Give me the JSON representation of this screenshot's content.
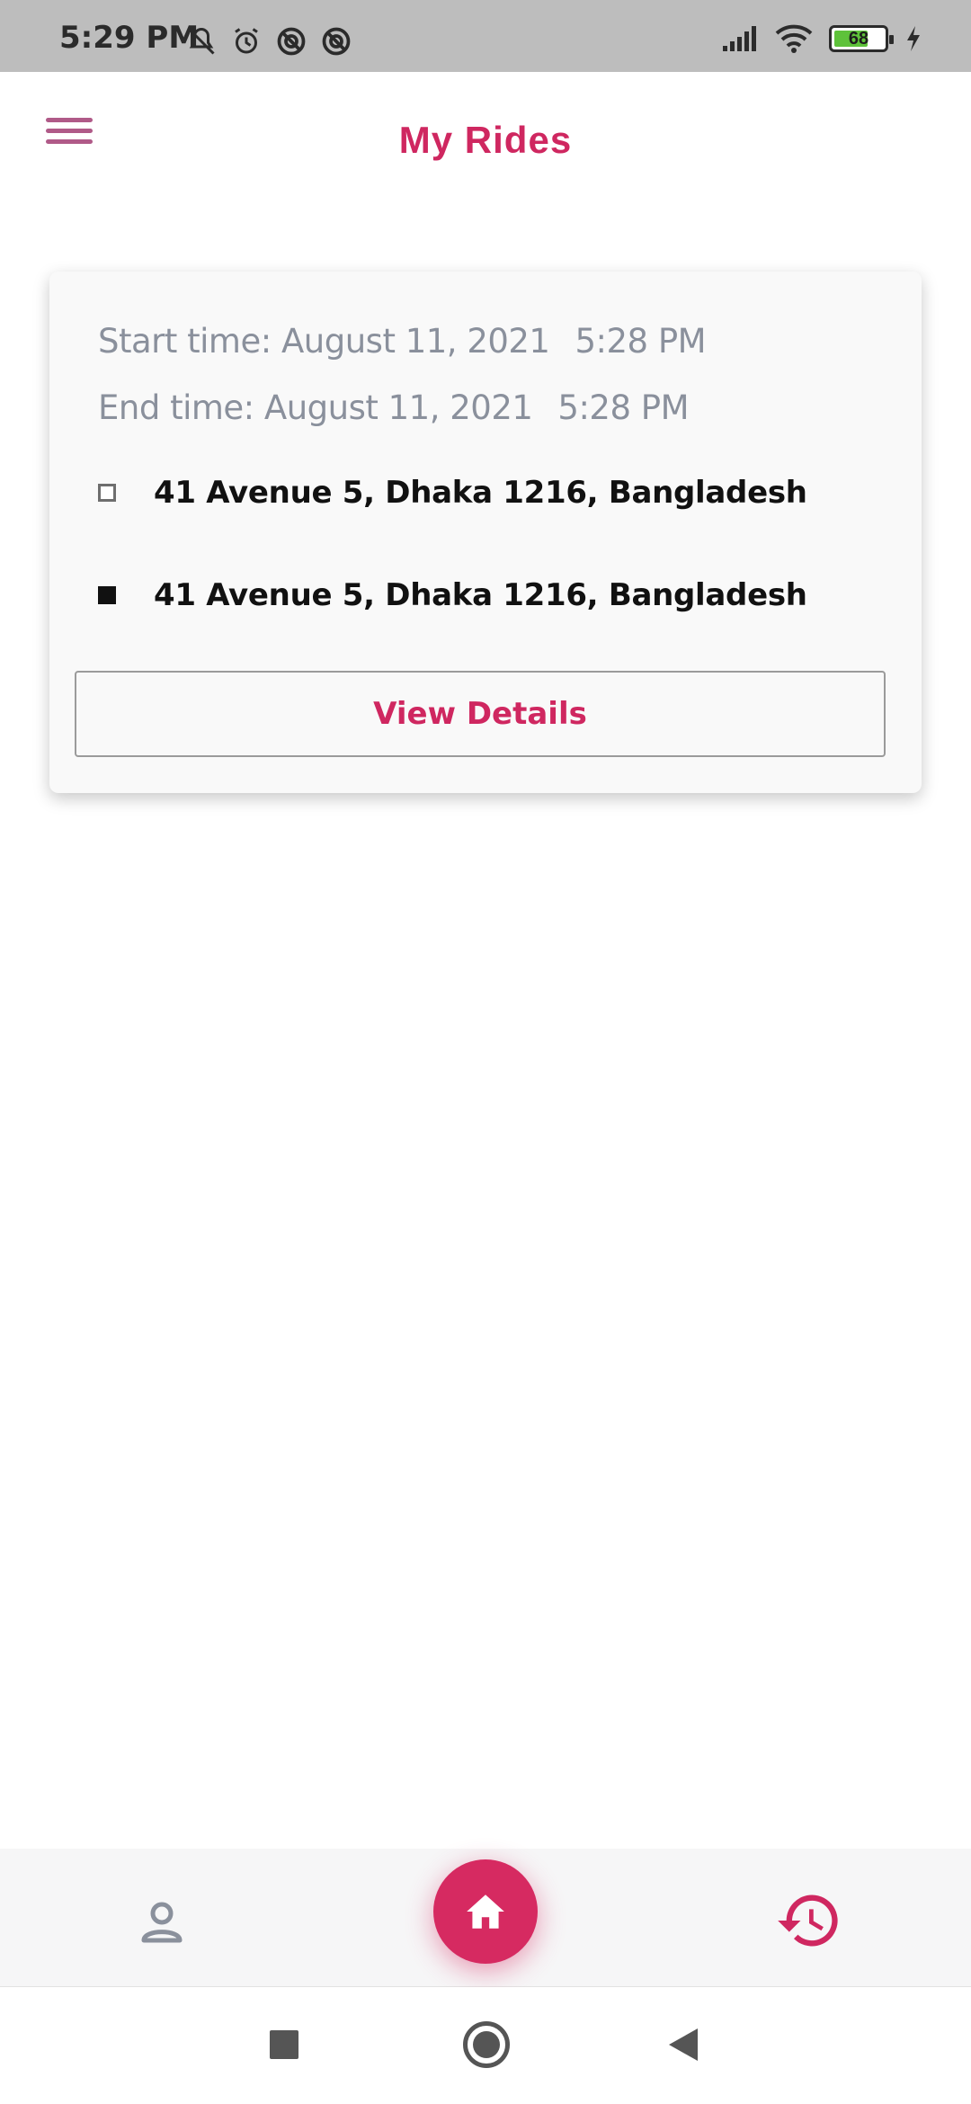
{
  "status_bar": {
    "time": "5:29 PM",
    "battery_level": "68",
    "battery_fraction": 0.68,
    "icons_left": [
      "mute-icon",
      "alarm-icon",
      "vpn-icon",
      "vpn-icon"
    ],
    "icons_right": [
      "signal-icon",
      "wifi-icon",
      "battery-icon",
      "charging-icon"
    ]
  },
  "app_bar": {
    "title": "My Rides",
    "menu_icon": "hamburger-menu-icon"
  },
  "rides": [
    {
      "start_label": "Start time: August 11, 2021",
      "start_time": "5:28 PM",
      "end_label": "End time: August 11, 2021",
      "end_time": "5:28 PM",
      "pickup": "41 Avenue 5, Dhaka 1216, Bangladesh",
      "dropoff": "41 Avenue 5, Dhaka 1216, Bangladesh",
      "action_label": "View Details"
    }
  ],
  "bottom_nav": {
    "items": [
      "profile-icon",
      "home-icon",
      "history-icon"
    ],
    "active": "home"
  },
  "colors": {
    "accent": "#cf2760",
    "menu": "#b05a88",
    "muted_text": "#8a909c"
  }
}
